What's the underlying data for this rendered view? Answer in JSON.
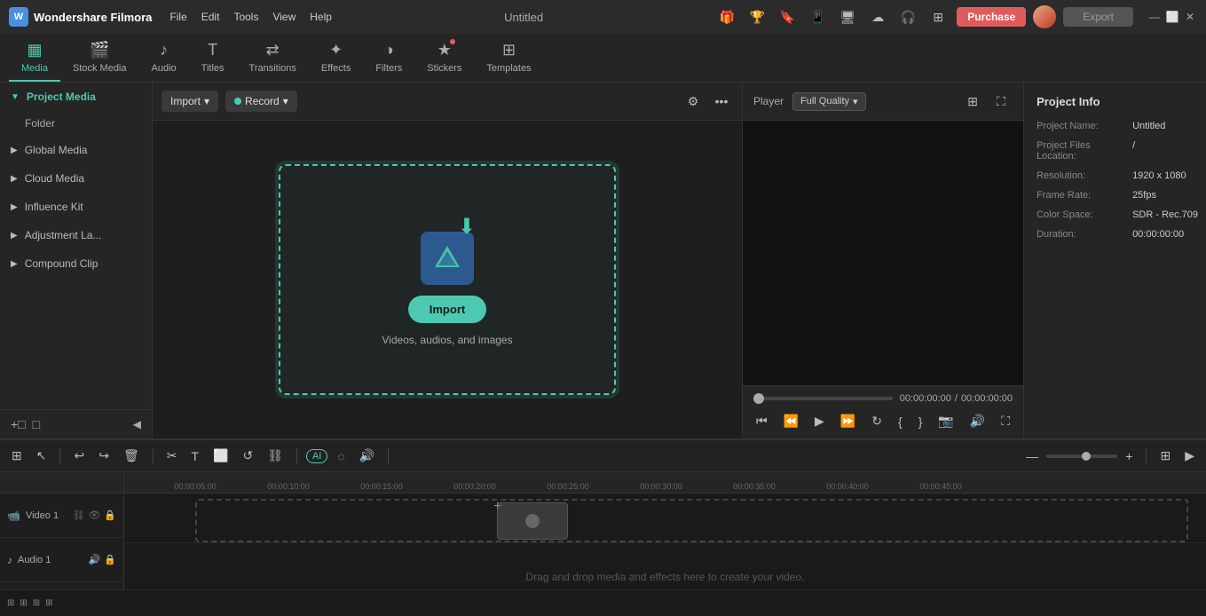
{
  "app": {
    "name": "Wondershare Filmora",
    "title": "Untitled"
  },
  "titlebar": {
    "menus": [
      "File",
      "Edit",
      "Tools",
      "View",
      "Help"
    ],
    "purchase_label": "Purchase",
    "export_label": "Export",
    "minimize": "—",
    "maximize": "⬜",
    "close": "✕"
  },
  "toolbar": {
    "tabs": [
      {
        "id": "media",
        "label": "Media",
        "icon": "▦",
        "active": true
      },
      {
        "id": "stock-media",
        "label": "Stock Media",
        "icon": "🎬"
      },
      {
        "id": "audio",
        "label": "Audio",
        "icon": "♪"
      },
      {
        "id": "titles",
        "label": "Titles",
        "icon": "T"
      },
      {
        "id": "transitions",
        "label": "Transitions",
        "icon": "⇄"
      },
      {
        "id": "effects",
        "label": "Effects",
        "icon": "✦"
      },
      {
        "id": "filters",
        "label": "Filters",
        "icon": "◑"
      },
      {
        "id": "stickers",
        "label": "Stickers",
        "icon": "★",
        "badge": true
      },
      {
        "id": "templates",
        "label": "Templates",
        "icon": "⊞"
      }
    ]
  },
  "sidebar": {
    "items": [
      {
        "id": "project-media",
        "label": "Project Media",
        "active": true
      },
      {
        "id": "folder",
        "label": "Folder"
      },
      {
        "id": "global-media",
        "label": "Global Media"
      },
      {
        "id": "cloud-media",
        "label": "Cloud Media"
      },
      {
        "id": "influence-kit",
        "label": "Influence Kit"
      },
      {
        "id": "adjustment-la",
        "label": "Adjustment La..."
      },
      {
        "id": "compound-clip",
        "label": "Compound Clip"
      }
    ],
    "bottom": {
      "add_folder": "+□",
      "folder_icon": "□"
    }
  },
  "media_panel": {
    "import_label": "Import",
    "record_label": "Record",
    "drop_zone": {
      "import_btn_label": "Import",
      "subtitle": "Videos, audios, and images"
    }
  },
  "player": {
    "label": "Player",
    "quality_label": "Full Quality",
    "current_time": "00:00:00:00",
    "total_time": "00:00:00:00",
    "controls": {
      "rewind": "⏮",
      "step_back": "⏪",
      "play": "▶",
      "step_fwd": "⏩",
      "loop": "↻",
      "mark_in": "{",
      "mark_out": "}",
      "split": "✂"
    }
  },
  "project_info": {
    "title": "Project Info",
    "fields": [
      {
        "label": "Project Name:",
        "value": "Untitled"
      },
      {
        "label": "Project Files Location:",
        "value": "/"
      },
      {
        "label": "Resolution:",
        "value": "1920 x 1080"
      },
      {
        "label": "Frame Rate:",
        "value": "25fps"
      },
      {
        "label": "Color Space:",
        "value": "SDR - Rec.709"
      },
      {
        "label": "Duration:",
        "value": "00:00:00:00"
      }
    ]
  },
  "timeline": {
    "toolbar_buttons": [
      "⊞",
      "↖",
      "↩",
      "↪",
      "🗑",
      "✂",
      "T",
      "⬜",
      "↺",
      "⛓"
    ],
    "ruler_marks": [
      "00:00:05:00",
      "00:00:10:00",
      "00:00:15:00",
      "00:00:20:00",
      "00:00:25:00",
      "00:00:30:00",
      "00:00:35:00",
      "00:00:40:00",
      "00:00:45:00"
    ],
    "tracks": [
      {
        "label": "Video 1",
        "type": "video"
      },
      {
        "label": "Audio 1",
        "type": "audio"
      }
    ],
    "bottom_hint": "Drag and drop media and effects here to create your video.",
    "track_add_buttons": [
      "⊞",
      "⊞",
      "⊞",
      "⊞"
    ]
  }
}
